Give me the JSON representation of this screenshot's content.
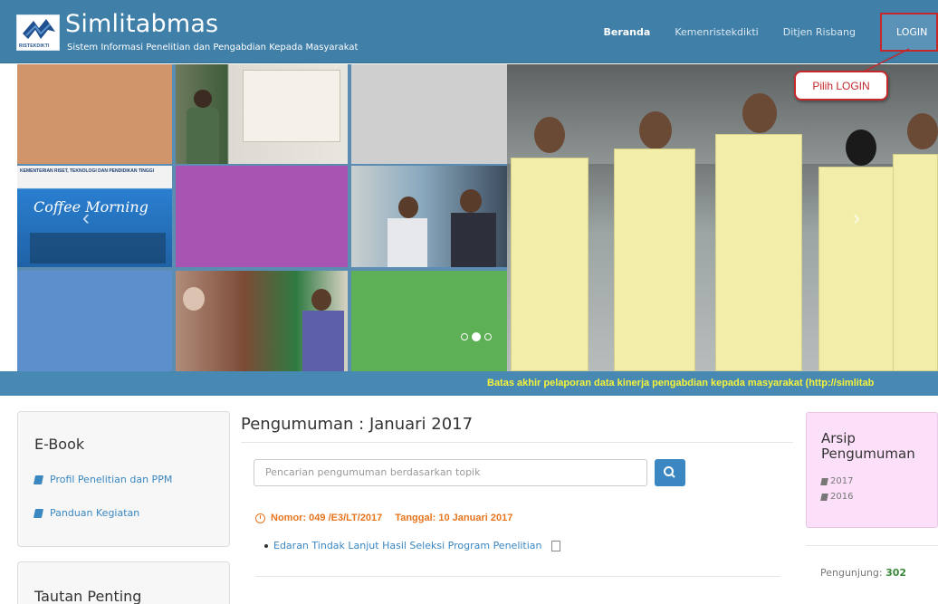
{
  "header": {
    "brand_title": "Simlitabmas",
    "brand_subtitle": "Sistem Informasi Penelitian dan Pengabdian Kepada Masyarakat",
    "logo_text": "RISTEKDIKTI",
    "nav": [
      {
        "label": "Beranda",
        "active": true
      },
      {
        "label": "Kemenristekdikti",
        "active": false
      },
      {
        "label": "Ditjen Risbang",
        "active": false
      }
    ],
    "login_label": "LOGIN"
  },
  "callout": {
    "label": "Pilih LOGIN"
  },
  "hero": {
    "coffee_banner": "KEMENTERIAN RISET, TEKNOLOGI DAN PENDIDIKAN TINGGI",
    "coffee_text": "Coffee Morning",
    "carousel_dots": 3,
    "active_dot": 2
  },
  "ticker": {
    "text": "Batas akhir pelaporan data kinerja pengabdian kepada masyarakat (http://simlitab"
  },
  "sidebar": {
    "ebook_title": "E-Book",
    "ebook_links": [
      "Profil Penelitian dan PPM",
      "Panduan Kegiatan"
    ],
    "tautan_title": "Tautan Penting"
  },
  "main": {
    "title": "Pengumuman : Januari 2017",
    "search_placeholder": "Pencarian pengumuman berdasarkan topik",
    "items": [
      {
        "nomor": "Nomor: 049 /E3/LT/2017",
        "tanggal": "Tanggal: 10 Januari 2017",
        "link": "Edaran Tindak Lanjut Hasil Seleksi Program Penelitian"
      }
    ]
  },
  "arsip": {
    "title_line1": "Arsip",
    "title_line2": "Pengumuman",
    "years": [
      "2017",
      "2016"
    ]
  },
  "pengunjung": {
    "label": "Pengunjung:",
    "count": "302"
  },
  "colors": {
    "header_bg": "#3f7fa8",
    "accent_red": "#c4282a",
    "ticker_bg": "#4789b3",
    "ticker_text": "#f6f33a",
    "link_blue": "#3a87c2",
    "announcement_orange": "#e8751e",
    "arsip_bg": "#fcdff8"
  }
}
